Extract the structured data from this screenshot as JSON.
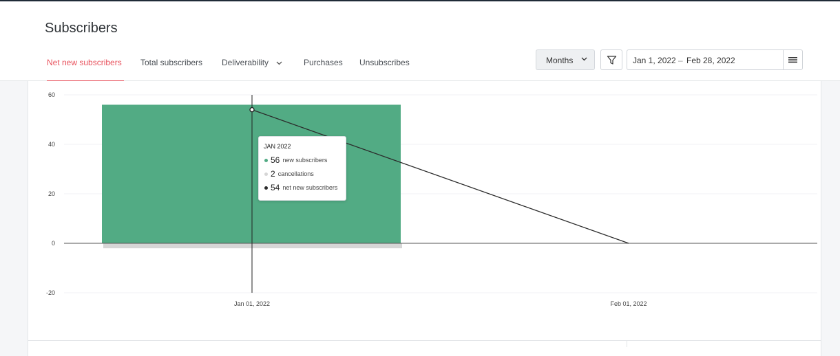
{
  "page": {
    "title": "Subscribers"
  },
  "tabs": [
    {
      "label": "Net new subscribers",
      "active": true
    },
    {
      "label": "Total subscribers"
    },
    {
      "label": "Deliverability",
      "has_dropdown": true
    },
    {
      "label": "Purchases"
    },
    {
      "label": "Unsubscribes"
    }
  ],
  "controls": {
    "period": "Months",
    "date_start": "Jan 1, 2022",
    "date_separator": "–",
    "date_end": "Feb 28, 2022"
  },
  "icons": {
    "period_chevron": "chevron-down-icon",
    "filter": "filter-icon",
    "menu": "hamburger-menu-icon"
  },
  "colors": {
    "accent": "#e8505b",
    "new_subscribers": "#52ab84",
    "cancellations": "#d6d6d6",
    "net_line": "#2b2b2b"
  },
  "chart_data": {
    "type": "bar",
    "categories": [
      "Jan 01, 2022",
      "Feb 01, 2022"
    ],
    "y_ticks": [
      60,
      40,
      20,
      0,
      -20
    ],
    "ylim": [
      -20,
      60
    ],
    "series": [
      {
        "name": "new subscribers",
        "type": "bar",
        "values": [
          56,
          0
        ]
      },
      {
        "name": "cancellations",
        "type": "bar",
        "values": [
          -2,
          0
        ]
      },
      {
        "name": "net new subscribers",
        "type": "line",
        "values": [
          54,
          0
        ]
      }
    ],
    "tooltip": {
      "title": "JAN 2022",
      "rows": [
        {
          "value": "56",
          "label": "new subscribers"
        },
        {
          "value": "2",
          "label": "cancellations"
        },
        {
          "value": "54",
          "label": "net new subscribers"
        }
      ]
    }
  }
}
